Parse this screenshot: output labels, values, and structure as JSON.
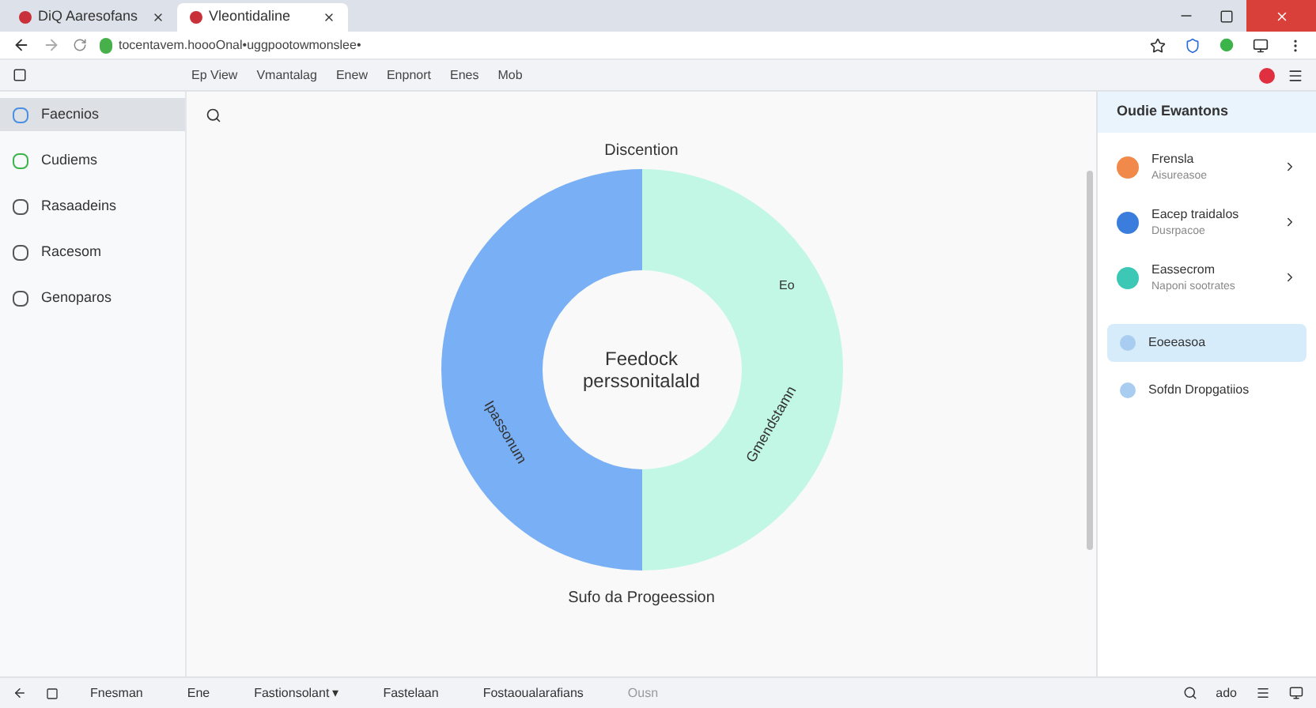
{
  "tabs": [
    {
      "label": "DiQ Aaresofans",
      "selected": false
    },
    {
      "label": "Vleontidaline",
      "selected": true
    }
  ],
  "address_bar": {
    "url": "tocentavem.hoooOnal•uggpootowmonslee•"
  },
  "toolbar": {
    "items": [
      {
        "label": "Ep View"
      },
      {
        "label": "Vmantalag"
      },
      {
        "label": "Enew"
      },
      {
        "label": "Enpnort"
      },
      {
        "label": "Enes"
      },
      {
        "label": "Mob"
      }
    ]
  },
  "sidebar": {
    "items": [
      {
        "label": "Faecnios",
        "selected": true,
        "color": "#4a90e2"
      },
      {
        "label": "Cudiems",
        "selected": false,
        "color": "#3bb54a"
      },
      {
        "label": "Rasaadeins",
        "selected": false,
        "color": "#555555"
      },
      {
        "label": "Racesom",
        "selected": false,
        "color": "#555555"
      },
      {
        "label": "Genoparos",
        "selected": false,
        "color": "#555555"
      }
    ]
  },
  "chart": {
    "title": "Discention",
    "center_line_1": "Feedock",
    "center_line_2": "perssonitalald",
    "left_label": "Ipassonum",
    "right_label": "Gmendstamn",
    "small_label": "Eo",
    "bottom_label": "Sufo da Progeession"
  },
  "panel": {
    "title": "Oudie Ewantons",
    "cards": [
      {
        "title": "Frensla",
        "subtitle": "Aisureasoe",
        "color": "#f0894a"
      },
      {
        "title": "Eacep traidalos",
        "subtitle": "Dusrpacoe",
        "color": "#3b7ddd"
      },
      {
        "title": "Eassecrom",
        "subtitle": "Naponi sootrates",
        "color": "#3cc8b4"
      }
    ],
    "items": [
      {
        "label": "Eoeeasoa",
        "selected": true
      },
      {
        "label": "Sofdn Dropgatiios",
        "selected": false
      }
    ]
  },
  "status_bar": {
    "items": [
      {
        "label": "Fnesman",
        "kind": "text"
      },
      {
        "label": "Ene",
        "kind": "text"
      },
      {
        "label": "Fastionsolant",
        "kind": "dropdown",
        "caret": "▾"
      },
      {
        "label": "Fastelaan",
        "kind": "text"
      },
      {
        "label": "Fostaoualarafians",
        "kind": "text"
      },
      {
        "label": "Ousn",
        "kind": "muted"
      }
    ],
    "zoom": "ado"
  }
}
